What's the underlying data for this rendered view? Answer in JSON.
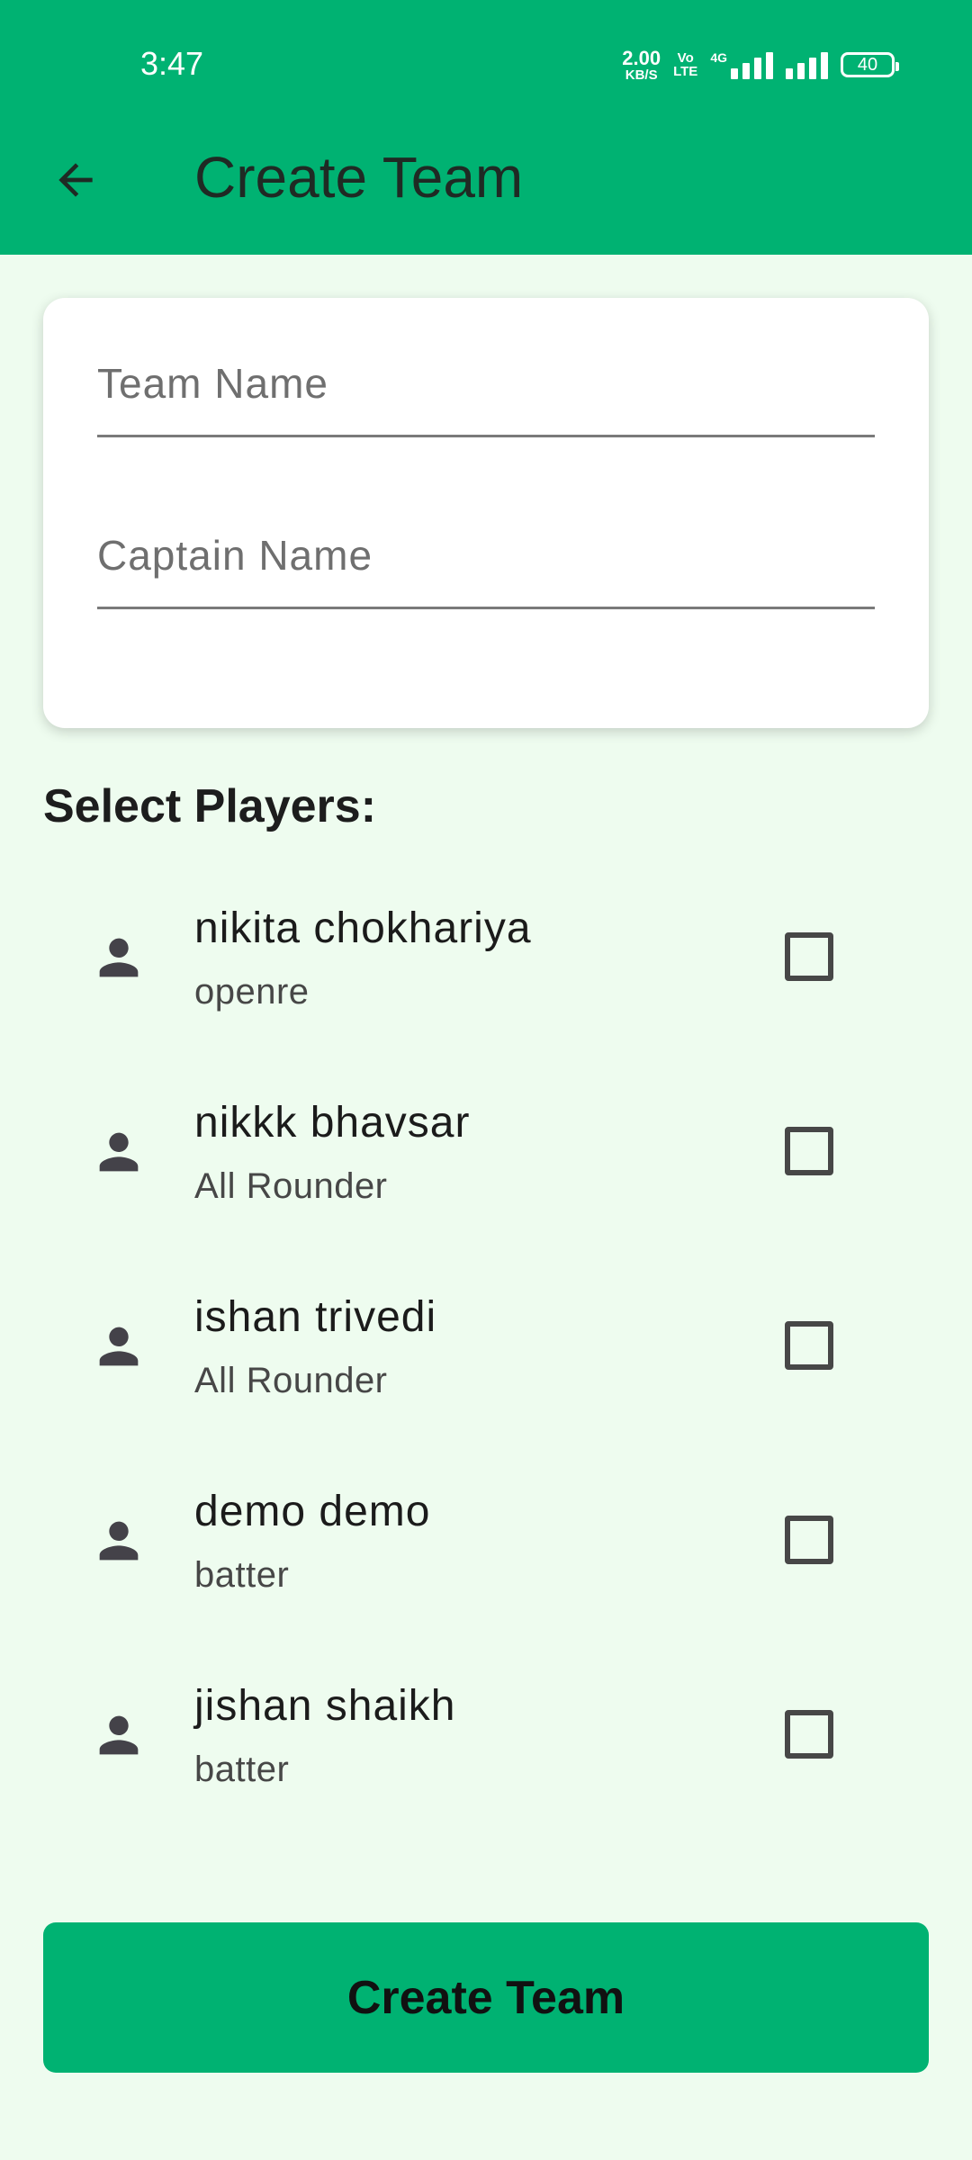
{
  "status_bar": {
    "time": "3:47",
    "net_speed_value": "2.00",
    "net_speed_unit": "KB/S",
    "volte_top": "Vo",
    "volte_bottom": "LTE",
    "signal_label": "4G",
    "battery": "40"
  },
  "appbar": {
    "title": "Create Team",
    "back_icon": "arrow-left-icon",
    "color": "#00b272"
  },
  "form": {
    "team_name_placeholder": "Team Name",
    "team_name_value": "",
    "captain_name_placeholder": "Captain Name",
    "captain_name_value": ""
  },
  "players_section": {
    "title": "Select Players:",
    "players": [
      {
        "name": "nikita chokhariya",
        "role": "openre",
        "checked": false
      },
      {
        "name": "nikkk bhavsar",
        "role": "All Rounder",
        "checked": false
      },
      {
        "name": "ishan trivedi",
        "role": "All Rounder",
        "checked": false
      },
      {
        "name": "demo demo",
        "role": "batter",
        "checked": false
      },
      {
        "name": "jishan shaikh",
        "role": "batter",
        "checked": false
      }
    ]
  },
  "actions": {
    "create_label": "Create Team"
  },
  "colors": {
    "primary": "#00b272",
    "background": "#eefcef"
  }
}
